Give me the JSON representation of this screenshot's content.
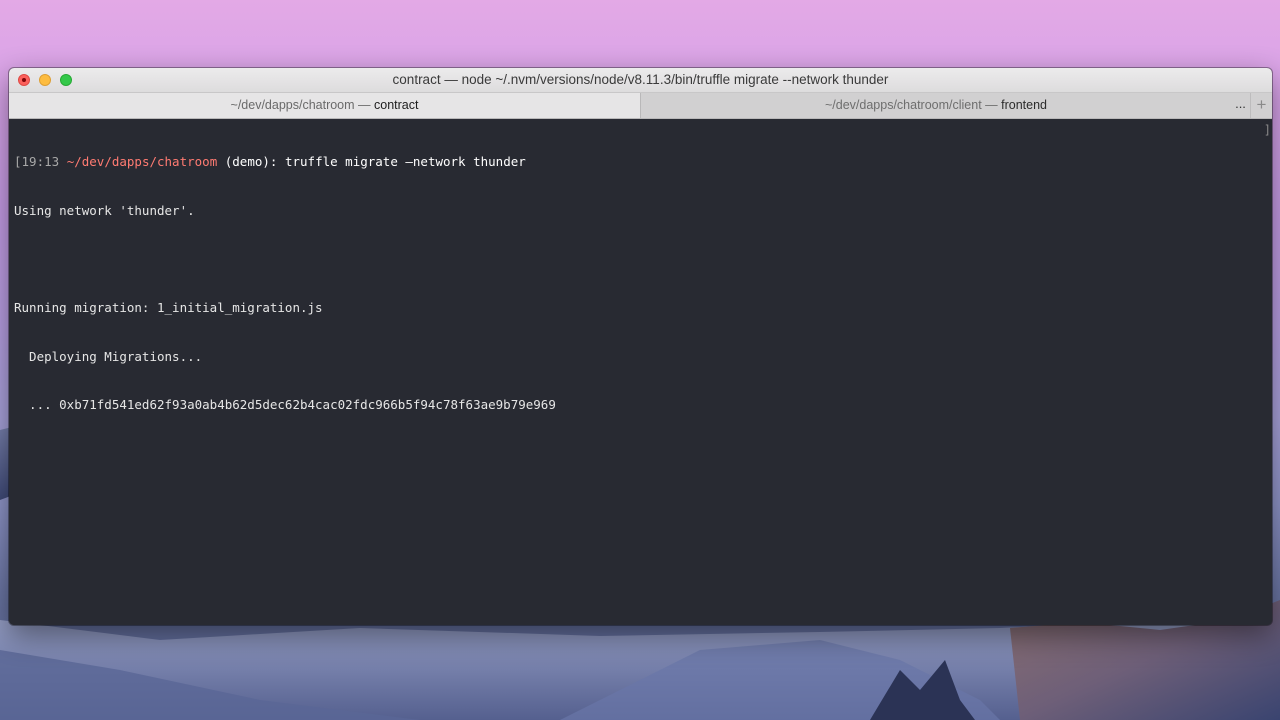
{
  "window": {
    "title": "contract — node ~/.nvm/versions/node/v8.11.3/bin/truffle migrate --network thunder"
  },
  "tabs": [
    {
      "prefix": "~/dev/dapps/chatroom — ",
      "name": "contract",
      "active": true
    },
    {
      "prefix": "~/dev/dapps/chatroom/client — ",
      "name": "frontend",
      "active": false
    }
  ],
  "tab_overflow_label": "...",
  "new_tab_label": "+",
  "terminal": {
    "prompt": {
      "bracket_open": "[",
      "time": "19:13",
      "path": "~/dev/dapps/chatroom",
      "branch": "(demo)",
      "separator": ": ",
      "command": "truffle migrate —network thunder"
    },
    "lines": [
      "Using network 'thunder'.",
      "",
      "Running migration: 1_initial_migration.js",
      "  Deploying Migrations...",
      "  ... 0xb71fd541ed62f93a0ab4b62d5dec62b4cac02fdc966b5f94c78f63ae9b79e969"
    ],
    "scroll_marker": "]"
  },
  "colors": {
    "terminal_bg": "#282a32",
    "prompt_path": "#ff7b72",
    "close": "#fc605c",
    "minimize": "#fdbc40",
    "zoom": "#34c84a"
  }
}
